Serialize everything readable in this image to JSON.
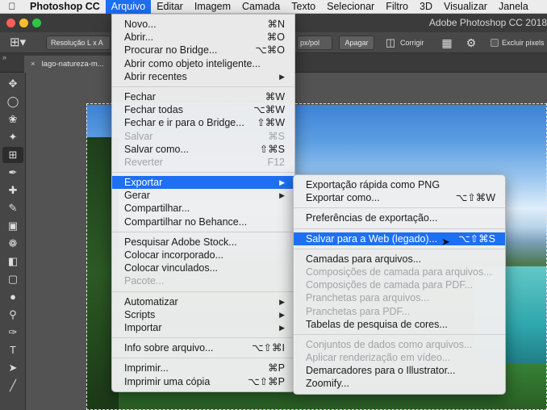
{
  "menubar": {
    "items": [
      "Photoshop CC",
      "Arquivo",
      "Editar",
      "Imagem",
      "Camada",
      "Texto",
      "Selecionar",
      "Filtro",
      "3D",
      "Visualizar",
      "Janela"
    ]
  },
  "app": {
    "title": "Adobe Photoshop CC 2018"
  },
  "options": {
    "ratio": "Resolução L x A",
    "unit": "px/pol",
    "clear": "Apagar",
    "straighten": "Corrigir",
    "delete_cropped": "Excluir pixels"
  },
  "tab": {
    "name": "lago-natureza-m..."
  },
  "file_menu": {
    "items": [
      {
        "label": "Novo...",
        "shortcut": "⌘N"
      },
      {
        "label": "Abrir...",
        "shortcut": "⌘O"
      },
      {
        "label": "Procurar no Bridge...",
        "shortcut": "⌥⌘O"
      },
      {
        "label": "Abrir como objeto inteligente...",
        "shortcut": ""
      },
      {
        "label": "Abrir recentes",
        "shortcut": ""
      },
      {
        "label": "Fechar",
        "shortcut": "⌘W"
      },
      {
        "label": "Fechar todas",
        "shortcut": "⌥⌘W"
      },
      {
        "label": "Fechar e ir para o Bridge...",
        "shortcut": "⇧⌘W"
      },
      {
        "label": "Salvar",
        "shortcut": "⌘S"
      },
      {
        "label": "Salvar como...",
        "shortcut": "⇧⌘S"
      },
      {
        "label": "Reverter",
        "shortcut": "F12"
      },
      {
        "label": "Exportar",
        "shortcut": ""
      },
      {
        "label": "Gerar",
        "shortcut": ""
      },
      {
        "label": "Compartilhar...",
        "shortcut": ""
      },
      {
        "label": "Compartilhar no Behance...",
        "shortcut": ""
      },
      {
        "label": "Pesquisar Adobe Stock...",
        "shortcut": ""
      },
      {
        "label": "Colocar incorporado...",
        "shortcut": ""
      },
      {
        "label": "Colocar vinculados...",
        "shortcut": ""
      },
      {
        "label": "Pacote...",
        "shortcut": ""
      },
      {
        "label": "Automatizar",
        "shortcut": ""
      },
      {
        "label": "Scripts",
        "shortcut": ""
      },
      {
        "label": "Importar",
        "shortcut": ""
      },
      {
        "label": "Info sobre arquivo...",
        "shortcut": "⌥⇧⌘I"
      },
      {
        "label": "Imprimir...",
        "shortcut": "⌘P"
      },
      {
        "label": "Imprimir uma cópia",
        "shortcut": "⌥⇧⌘P"
      }
    ]
  },
  "export_menu": {
    "items": [
      {
        "label": "Exportação rápida como PNG",
        "shortcut": ""
      },
      {
        "label": "Exportar como...",
        "shortcut": "⌥⇧⌘W"
      },
      {
        "label": "Preferências de exportação...",
        "shortcut": ""
      },
      {
        "label": "Salvar para a Web (legado)...",
        "shortcut": "⌥⇧⌘S"
      },
      {
        "label": "Camadas para arquivos...",
        "shortcut": ""
      },
      {
        "label": "Composições de camada para arquivos...",
        "shortcut": ""
      },
      {
        "label": "Composições de camada para PDF...",
        "shortcut": ""
      },
      {
        "label": "Pranchetas para arquivos...",
        "shortcut": ""
      },
      {
        "label": "Pranchetas para PDF...",
        "shortcut": ""
      },
      {
        "label": "Tabelas de pesquisa de cores...",
        "shortcut": ""
      },
      {
        "label": "Conjuntos de dados como arquivos...",
        "shortcut": ""
      },
      {
        "label": "Aplicar renderização em vídeo...",
        "shortcut": ""
      },
      {
        "label": "Demarcadores para o Illustrator...",
        "shortcut": ""
      },
      {
        "label": "Zoomify...",
        "shortcut": ""
      }
    ]
  },
  "colors": {
    "highlight": "#1e6ff2",
    "disabled": "#a3a3a7"
  }
}
